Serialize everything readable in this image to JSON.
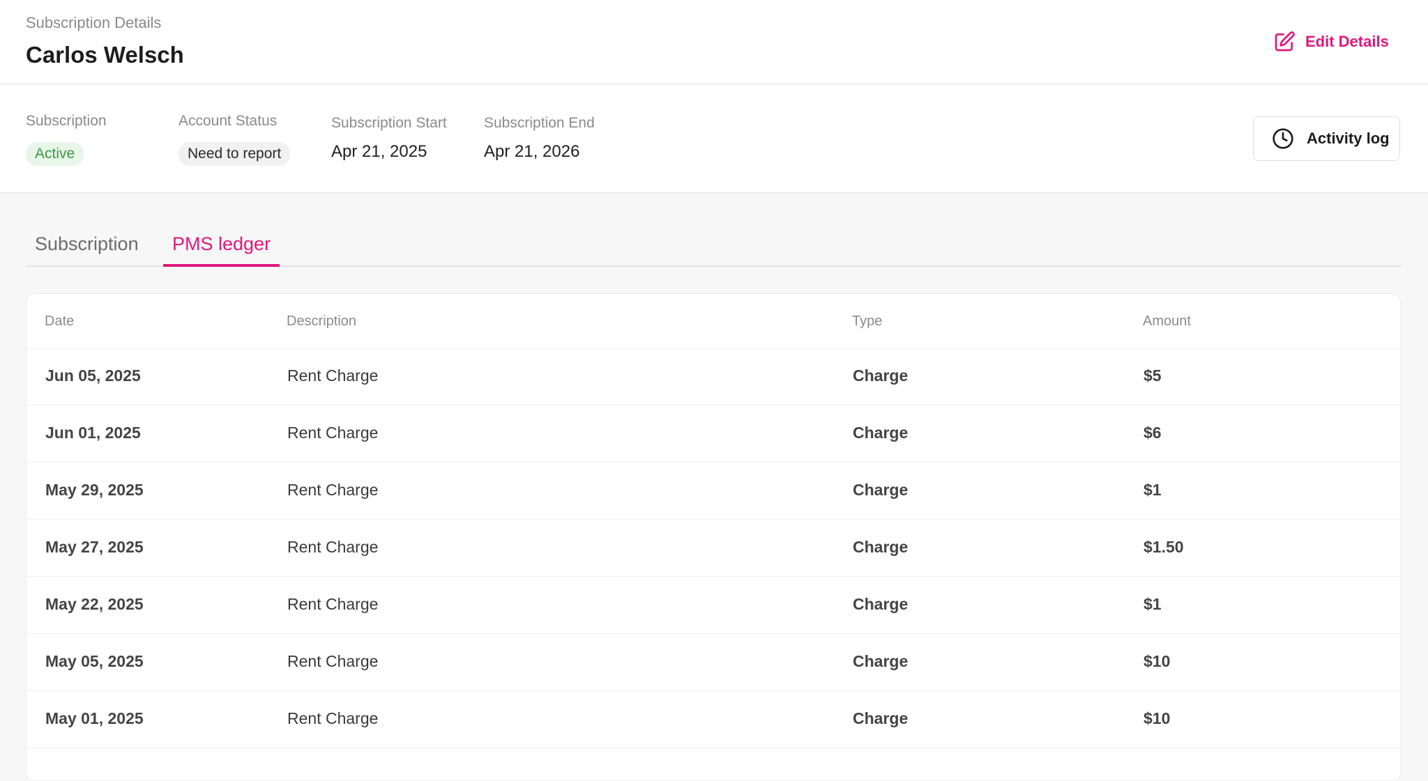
{
  "header": {
    "subtitle": "Subscription Details",
    "customer_name": "Carlos Welsch",
    "edit_label": "Edit Details"
  },
  "meta": {
    "subscription_label": "Subscription",
    "subscription_status": "Active",
    "account_status_label": "Account Status",
    "account_status": "Need to report",
    "start_label": "Subscription Start",
    "start_date": "Apr 21, 2025",
    "end_label": "Subscription End",
    "end_date": "Apr 21, 2026",
    "activity_label": "Activity log"
  },
  "tabs": [
    {
      "label": "Subscription",
      "active": false
    },
    {
      "label": "PMS ledger",
      "active": true
    }
  ],
  "ledger": {
    "columns": [
      "Date",
      "Description",
      "Type",
      "Amount"
    ],
    "rows": [
      {
        "date": "Jun 05, 2025",
        "description": "Rent Charge",
        "type": "Charge",
        "amount": "$5"
      },
      {
        "date": "Jun 01, 2025",
        "description": "Rent Charge",
        "type": "Charge",
        "amount": "$6"
      },
      {
        "date": "May 29, 2025",
        "description": "Rent Charge",
        "type": "Charge",
        "amount": "$1"
      },
      {
        "date": "May 27, 2025",
        "description": "Rent Charge",
        "type": "Charge",
        "amount": "$1.50"
      },
      {
        "date": "May 22, 2025",
        "description": "Rent Charge",
        "type": "Charge",
        "amount": "$1"
      },
      {
        "date": "May 05, 2025",
        "description": "Rent Charge",
        "type": "Charge",
        "amount": "$10"
      },
      {
        "date": "May 01, 2025",
        "description": "Rent Charge",
        "type": "Charge",
        "amount": "$10"
      }
    ]
  },
  "colors": {
    "accent": "#e0177f",
    "active_badge_bg": "#e8f6e9",
    "active_badge_text": "#3c9a44"
  },
  "icons": {
    "edit": "edit-icon",
    "activity": "clock-icon"
  }
}
